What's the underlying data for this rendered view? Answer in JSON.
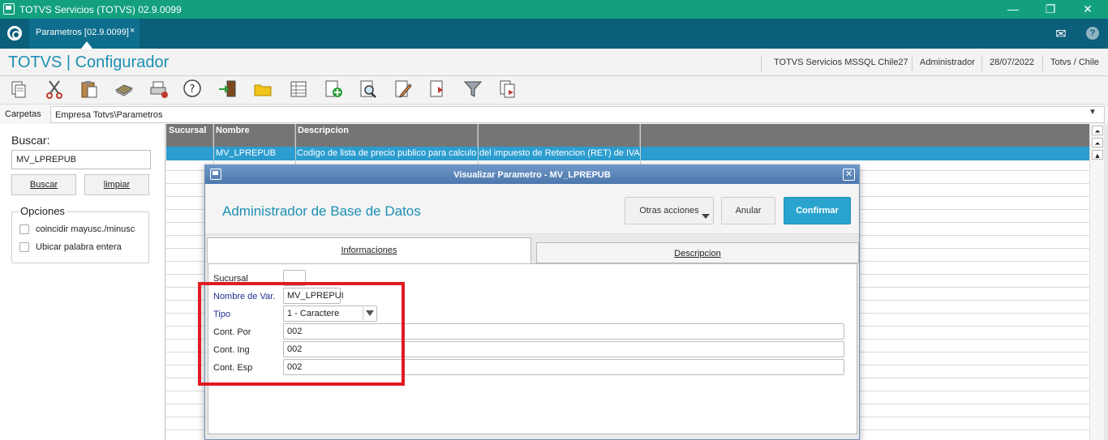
{
  "window": {
    "title": "TOTVS Servicios (TOTVS) 02.9.0099",
    "controls": {
      "minimize": "—",
      "restore": "❐",
      "close": "✕"
    }
  },
  "tabbar": {
    "tab_label": "Parametros [02.9.0099]",
    "tab_close": "×",
    "mail_icon": "✉",
    "help_icon": "?"
  },
  "header": {
    "app_title": "TOTVS | Configurador",
    "info": [
      "TOTVS Servicios MSSQL Chile27",
      "Administrador",
      "28/07/2022",
      "Totvs / Chile"
    ]
  },
  "toolbar": {
    "icons": [
      "copy-icon",
      "cut-icon",
      "paste-icon",
      "book-icon",
      "print-icon",
      "help-icon",
      "exit-icon",
      "folder-icon",
      "table-icon",
      "add-icon",
      "search-icon",
      "edit-icon",
      "delete-icon",
      "filter-icon",
      "docs-icon"
    ]
  },
  "pathbar": {
    "label": "Carpetas",
    "path": "Empresa Totvs\\Parametros",
    "arrow": "▼"
  },
  "search": {
    "title": "Buscar:",
    "value": "MV_LPREPUB",
    "buscar": "Buscar",
    "limpiar": "limpiar",
    "options_title": "Opciones",
    "opt1": "coincidir mayusc./minusc",
    "opt2": "Ubicar palabra entera"
  },
  "grid": {
    "headers": [
      "Sucursal",
      "Nombre",
      "Descripcion",
      ""
    ],
    "selected_row": {
      "sucursal": "",
      "nombre": "MV_LPREPUB",
      "descripcion": "Codigo de lista de precio publico para calculo",
      "extra": "del impuesto de Retencion (RET) de IVA"
    }
  },
  "scroll": {
    "top": "⏶",
    "up2": "⏶",
    "up": "▲"
  },
  "dialog": {
    "title": "Visualizar Parametro - MV_LPREPUB",
    "close": "✕",
    "header": "Administrador de Base de Datos",
    "btn_otras": "Otras acciones",
    "btn_anular": "Anular",
    "btn_confirmar": "Confirmar",
    "tab_info": "Informaciones",
    "tab_desc": "Descripcion",
    "fields": {
      "sucursal_label": "Sucursal",
      "sucursal_value": "",
      "nombre_label": "Nombre de Var.",
      "nombre_value": "MV_LPREPUI",
      "tipo_label": "Tipo",
      "tipo_value": "1 - Caractere",
      "por_label": "Cont. Por",
      "por_value": "002",
      "ing_label": "Cont. Ing",
      "ing_value": "002",
      "esp_label": "Cont. Esp",
      "esp_value": "002"
    }
  },
  "colors": {
    "titlebar": "#12a07e",
    "tabbar": "#0b5f7b",
    "accent": "#1c8fb3",
    "selection": "#2c9dcf",
    "highlight": "#e01b24"
  }
}
